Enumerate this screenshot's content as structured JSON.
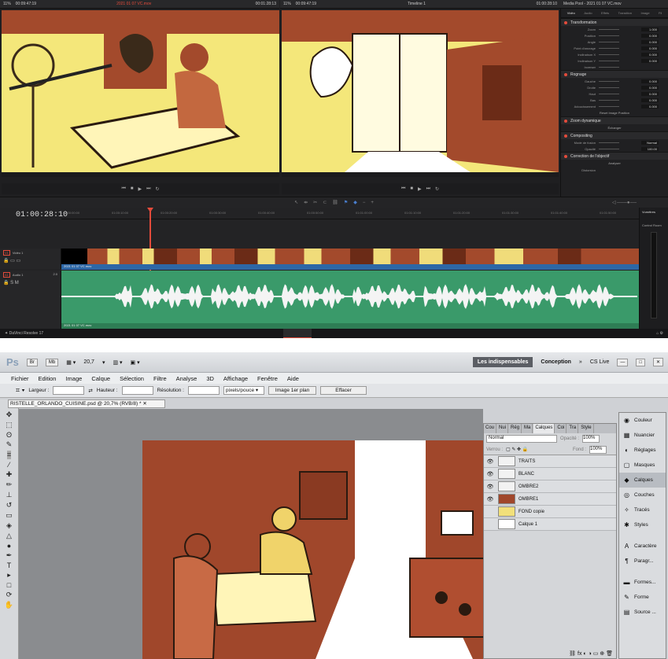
{
  "resolve": {
    "left_viewer": {
      "zoom": "11%",
      "timecode_in": "00:09:47:19",
      "clip": "2021 01 07 VC.mov",
      "timecode_out": "00:01:28:13"
    },
    "right_viewer": {
      "zoom": "11%",
      "timecode_in": "00:09:47:19",
      "timeline": "Timeline 1",
      "timecode_out": "01:00:28:10"
    },
    "inspector": {
      "title": "Media Pool - 2021 01 07 VC.mov",
      "tabs": [
        "Vidéo",
        "Audio",
        "Effets",
        "Transition",
        "Image",
        "Fil"
      ],
      "sections": [
        {
          "name": "Transformation",
          "rows": [
            [
              "Zoom",
              "1.000"
            ],
            [
              "Position",
              "0.000"
            ],
            [
              "Angle",
              "0.000"
            ],
            [
              "Point d'ancrage",
              "0.000"
            ],
            [
              "Inclinaison X",
              "0.000"
            ],
            [
              "Inclinaison Y",
              "0.000"
            ],
            [
              "Inverser",
              ""
            ]
          ]
        },
        {
          "name": "Rognage",
          "rows": [
            [
              "Gauche",
              "0.000"
            ],
            [
              "Droite",
              "0.000"
            ],
            [
              "Haut",
              "0.000"
            ],
            [
              "Bas",
              "0.000"
            ],
            [
              "Adoucissement",
              "0.000"
            ]
          ],
          "button": "Reset Image Position"
        },
        {
          "name": "Zoom dynamique",
          "rows": [],
          "button": "Échanger"
        },
        {
          "name": "Compositing",
          "rows": [
            [
              "Mode de fusion",
              "Normal"
            ],
            [
              "Opacité",
              "100.00"
            ]
          ]
        },
        {
          "name": "Correction de l'objectif",
          "rows": [],
          "button": "Analyser"
        }
      ],
      "zoom_y": "1.000",
      "position_y": "0.000",
      "anchor_y": "0.000",
      "distortion_label": "Distorsion"
    },
    "timeline": {
      "timecode": "01:00:28:10",
      "ruler": [
        "01:00:00:00",
        "01:00:10:00",
        "01:00:20:00",
        "01:00:30:00",
        "01:00:40:00",
        "01:00:50:00",
        "01:01:00:00",
        "01:01:10:00",
        "01:01:20:00",
        "01:01:30:00",
        "01:01:40:00",
        "01:01:50:00"
      ],
      "video_track": {
        "id": "V1",
        "name": "Vidéo 1",
        "clip": "2021 01 07 VC.mov"
      },
      "audio_track": {
        "id": "A1",
        "name": "Audio 1",
        "level": "2.0",
        "clip": "2021 01 07 VC.mov"
      }
    },
    "meters": {
      "title": "Vumètres",
      "label": "Control Room"
    },
    "app": "DaVinci Resolve 17"
  },
  "photoshop": {
    "logo": "Ps",
    "zoom": "20,7",
    "workspace": {
      "active": "Les indispensables",
      "other": "Conception",
      "cslive": "CS Live"
    },
    "menu": [
      "Fichier",
      "Edition",
      "Image",
      "Calque",
      "Sélection",
      "Filtre",
      "Analyse",
      "3D",
      "Affichage",
      "Fenêtre",
      "Aide"
    ],
    "options": {
      "width": "Largeur :",
      "height": "Hauteur :",
      "resolution": "Résolution :",
      "unit": "pixels/pouce",
      "front": "Image 1er plan",
      "clear": "Effacer"
    },
    "document": "RISTELLE_ORLANDO_CUISINE.psd @ 20,7% (RVB/8) *",
    "layers_panel": {
      "tabs": [
        "Cou",
        "Nui",
        "Rég",
        "Ma",
        "Calques",
        "Coi",
        "Tra",
        "Style"
      ],
      "blend": "Normal",
      "opacity_label": "Opacité :",
      "opacity": "100%",
      "lock_label": "Verrou :",
      "fill_label": "Fond :",
      "fill": "100%",
      "layers": [
        {
          "name": "TRAITS",
          "color": "#f2f2f2"
        },
        {
          "name": "BLANC",
          "color": "#f2f2f2"
        },
        {
          "name": "OMBRE2",
          "color": "#f2f2f2"
        },
        {
          "name": "OMBRE1",
          "color": "#a0472b"
        },
        {
          "name": "FOND copie",
          "color": "#f2e07a"
        },
        {
          "name": "Calque 1",
          "color": "#ffffff"
        }
      ]
    },
    "dock": [
      "Couleur",
      "Nuancier",
      "Réglages",
      "Masques",
      "Calques",
      "Couches",
      "Tracés",
      "Styles",
      "Caractère",
      "Paragr...",
      "Formes...",
      "Forme",
      "Source ..."
    ]
  }
}
